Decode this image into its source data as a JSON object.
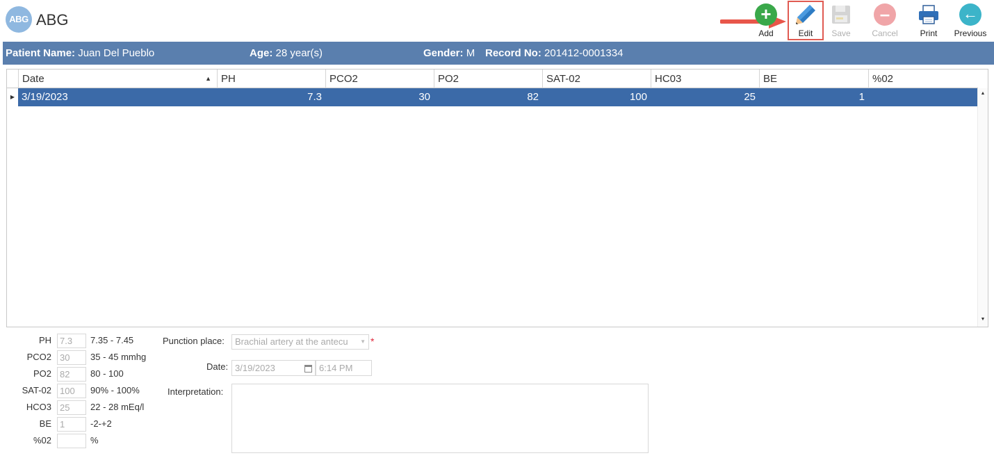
{
  "app": {
    "logo_text": "ABG",
    "title": "ABG"
  },
  "toolbar": {
    "add": "Add",
    "edit": "Edit",
    "save": "Save",
    "cancel": "Cancel",
    "print": "Print",
    "previous": "Previous"
  },
  "patient": {
    "name_label": "Patient Name:",
    "name": "Juan Del Pueblo",
    "age_label": "Age:",
    "age": "28 year(s)",
    "gender_label": "Gender:",
    "gender": "M",
    "record_label": "Record No:",
    "record": "201412-0001334"
  },
  "grid": {
    "columns": [
      "Date",
      "PH",
      "PCO2",
      "PO2",
      "SAT-02",
      "HC03",
      "BE",
      "%02"
    ],
    "rows": [
      [
        "3/19/2023",
        "7.3",
        "30",
        "82",
        "100",
        "25",
        "1",
        ""
      ]
    ]
  },
  "labs": [
    {
      "label": "PH",
      "value": "7.3",
      "range": "7.35 - 7.45"
    },
    {
      "label": "PCO2",
      "value": "30",
      "range": "35 - 45 mmhg"
    },
    {
      "label": "PO2",
      "value": "82",
      "range": "80 - 100"
    },
    {
      "label": "SAT-02",
      "value": "100",
      "range": "90% - 100%"
    },
    {
      "label": "HCO3",
      "value": "25",
      "range": "22 - 28 mEq/l"
    },
    {
      "label": "BE",
      "value": "1",
      "range": "-2-+2"
    },
    {
      "label": "%02",
      "value": "",
      "range": "%"
    }
  ],
  "form": {
    "punction_label": "Punction place:",
    "punction_value": "Brachial artery at the antecu",
    "date_label": "Date:",
    "date_value": "3/19/2023",
    "time_value": "6:14 PM",
    "interpretation_label": "Interpretation:",
    "interpretation_value": "",
    "required_mark": "*"
  },
  "colors": {
    "patient_bar": "#5a7fae",
    "selected_row": "#3b6aa8",
    "highlight_border": "#e05a52"
  }
}
